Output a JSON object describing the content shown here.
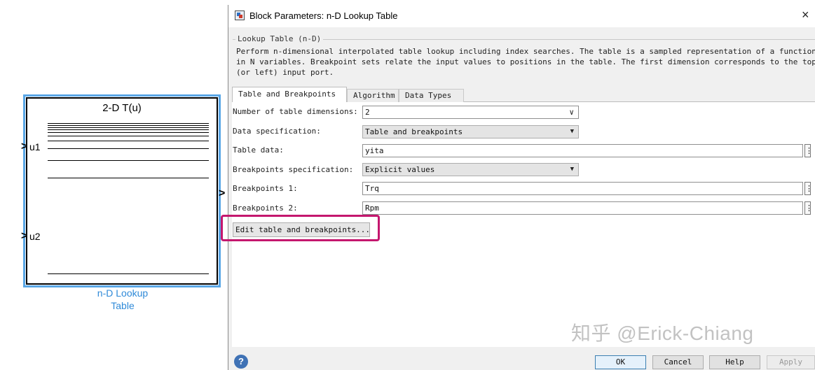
{
  "canvas": {
    "block_title": "2-D T(u)",
    "port_1": "u1",
    "port_2": "u2",
    "block_name_line1": "n-D Lookup",
    "block_name_line2": "Table"
  },
  "dialog": {
    "title": "Block Parameters: n-D Lookup Table",
    "close_glyph": "×",
    "group_label": "Lookup Table (n-D)",
    "description": "Perform n-dimensional interpolated table lookup including index searches. The table is a sampled representation of a function in N variables. Breakpoint sets relate the input values to positions in the table. The first dimension corresponds to the top (or left) input port.",
    "tabs": [
      "Table and Breakpoints",
      "Algorithm",
      "Data Types"
    ],
    "active_tab": "Table and Breakpoints",
    "fields": {
      "num_dims_label": "Number of table dimensions:",
      "num_dims_value": "2",
      "data_spec_label": "Data specification:",
      "data_spec_value": "Table and breakpoints",
      "table_data_label": "Table data:",
      "table_data_value": "yita",
      "bp_spec_label": "Breakpoints specification:",
      "bp_spec_value": "Explicit values",
      "bp1_label": "Breakpoints 1:",
      "bp1_value": "Trq",
      "bp2_label": "Breakpoints 2:",
      "bp2_value": "Rpm"
    },
    "more_glyph": "⋮",
    "caret_glyph": "▼",
    "caret_outline_glyph": "∨",
    "edit_button": "Edit table and breakpoints...",
    "buttons": {
      "ok": "OK",
      "cancel": "Cancel",
      "help": "Help",
      "apply": "Apply"
    },
    "help_glyph": "?"
  },
  "watermark": "知乎 @Erick-Chiang",
  "colors": {
    "selection": "#5aa7e6",
    "block_label": "#2f8ad8",
    "highlight": "#c4176e"
  }
}
